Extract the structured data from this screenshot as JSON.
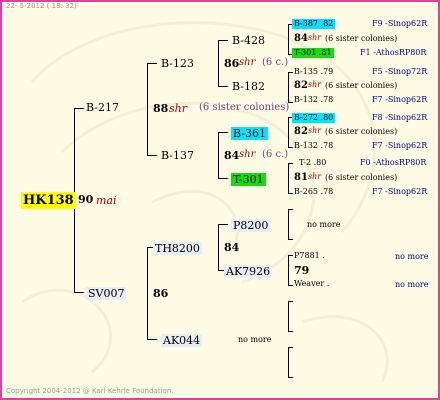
{
  "header": {
    "date": "22-  5-2012 ( 18: 32)"
  },
  "footer": {
    "copyright": "Copyright 2004-2012 @ Karl Kehrle Foundation."
  },
  "root": {
    "name": "HK138",
    "gen": "90",
    "race": "mai"
  },
  "gen1": {
    "father": {
      "name": "B-217",
      "gen": "88",
      "race": "shr",
      "note": "(6 sister colonies)"
    },
    "mother": {
      "name": "SV007",
      "gen": "86"
    }
  },
  "gen2": {
    "ff": {
      "name": "B-123",
      "gen": "86",
      "race": "shr",
      "note": "(6 c.)"
    },
    "fm": {
      "name": "B-137",
      "gen": "84",
      "race": "shr",
      "note": "(6 c.)"
    },
    "mf": {
      "name": "TH8200",
      "gen": "84"
    },
    "mm": {
      "name": "AK044",
      "note": "no more"
    }
  },
  "gen3": {
    "a": {
      "name": "B-428"
    },
    "b": {
      "name": "B-182"
    },
    "c": {
      "name": "B-361"
    },
    "d": {
      "name": "T-301"
    },
    "e": {
      "name": "P8200",
      "note": "no more"
    },
    "f": {
      "name": "AK7926",
      "gen": "79"
    }
  },
  "gen4": [
    {
      "label": "B-387 .82",
      "right": "F9 -Sinop62R"
    },
    {
      "label": "84",
      "race": "shr",
      "note": "(6 sister colonies)"
    },
    {
      "label": "T-301 .81",
      "right": "F1 -AthosRP80R"
    },
    {
      "label": "B-135 .79",
      "right": "F5 -Sinop72R"
    },
    {
      "label": "82",
      "race": "shr",
      "note": "(6 sister colonies)"
    },
    {
      "label": "B-132 .78",
      "right": "F7 -Sinop62R"
    },
    {
      "label": "B-272 .80",
      "right": "F8 -Sinop62R"
    },
    {
      "label": "82",
      "race": "shr",
      "note": "(6 sister colonies)"
    },
    {
      "label": "B-132 .78",
      "right": "F7 -Sinop62R"
    },
    {
      "label": "T-2 .80",
      "right": "F0 -AthosRP80R"
    },
    {
      "label": "81",
      "race": "shr",
      "note": "(6 sister colonies)"
    },
    {
      "label": "B-265 .78",
      "right": "F7 -Sinop62R"
    },
    {
      "label": "P7881 .",
      "right": "no more"
    },
    {
      "label": "Weaver .",
      "right": "no more"
    }
  ]
}
